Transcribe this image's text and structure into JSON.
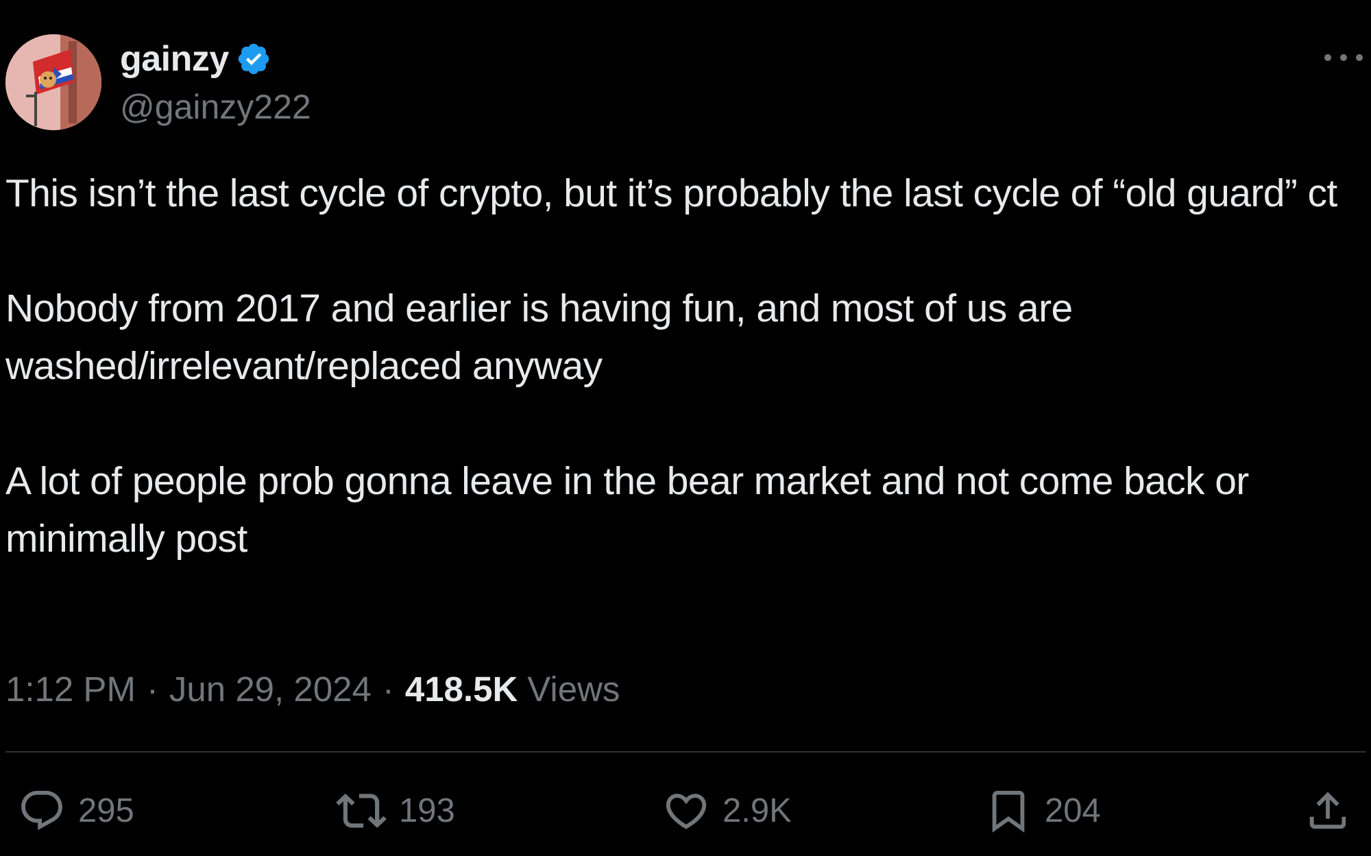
{
  "tweet": {
    "author": {
      "display_name": "gainzy",
      "handle": "@gainzy222",
      "verified": true
    },
    "text": {
      "paragraph_1": "This isn’t the last cycle of crypto, but it’s probably the last cycle of “old guard” ct",
      "paragraph_2": "Nobody from 2017 and earlier is having fun, and most of us are washed/irrelevant/replaced anyway",
      "paragraph_3": "A lot of people prob gonna leave in the bear market and not come back or minimally post"
    },
    "meta": {
      "time": "1:12 PM",
      "separator": "·",
      "date": "Jun 29, 2024",
      "views_count": "418.5K",
      "views_label": "Views"
    },
    "actions": {
      "replies": "295",
      "reposts": "193",
      "likes": "2.9K",
      "bookmarks": "204"
    },
    "icons": {
      "verified": "verified-badge-icon",
      "more": "more-horizontal-icon",
      "reply": "reply-bubble-icon",
      "repost": "repost-arrows-icon",
      "like": "heart-icon",
      "bookmark": "bookmark-icon",
      "share": "share-upload-icon"
    },
    "colors": {
      "background": "#000000",
      "text_primary": "#e7e9ea",
      "text_secondary": "#71767b",
      "verified_blue": "#1d9bf0",
      "divider": "#2f3336"
    }
  }
}
